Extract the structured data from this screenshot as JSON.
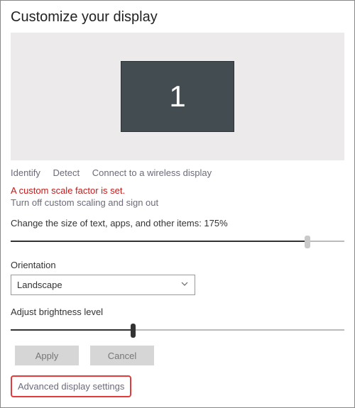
{
  "header": {
    "title": "Customize your display"
  },
  "monitor": {
    "number": "1"
  },
  "links": {
    "identify": "Identify",
    "detect": "Detect",
    "connect": "Connect to a wireless display"
  },
  "scale": {
    "warning": "A custom scale factor is set.",
    "turn_off": "Turn off custom scaling and sign out",
    "size_label": "Change the size of text, apps, and other items: 175%",
    "slider_percent": 88
  },
  "orientation": {
    "label": "Orientation",
    "value": "Landscape"
  },
  "brightness": {
    "label": "Adjust brightness level",
    "slider_percent": 36
  },
  "buttons": {
    "apply": "Apply",
    "cancel": "Cancel"
  },
  "advanced": {
    "label": "Advanced display settings"
  }
}
